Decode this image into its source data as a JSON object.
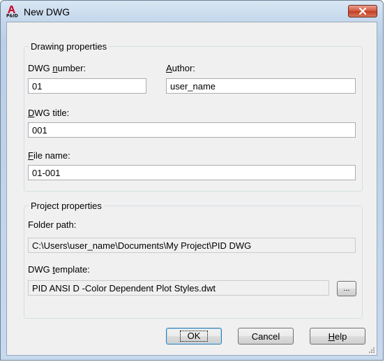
{
  "window": {
    "title": "New DWG",
    "icon": "autocad-pid-app-icon",
    "close_icon": "close-icon"
  },
  "drawing_properties": {
    "legend": "Drawing properties",
    "dwg_number": {
      "label_pre": "DWG ",
      "label_accel": "n",
      "label_post": "umber:",
      "value": "01"
    },
    "author": {
      "label_pre": "",
      "label_accel": "A",
      "label_post": "uthor:",
      "value": "user_name"
    },
    "dwg_title": {
      "label_pre": "",
      "label_accel": "D",
      "label_post": "WG title:",
      "value": "001"
    },
    "file_name": {
      "label_pre": "",
      "label_accel": "F",
      "label_post": "ile name:",
      "value": "01-001"
    }
  },
  "project_properties": {
    "legend": "Project properties",
    "folder_path": {
      "label": "Folder path:",
      "value": "C:\\Users\\user_name\\Documents\\My Project\\PID DWG"
    },
    "dwg_template": {
      "label_pre": "DWG ",
      "label_accel": "t",
      "label_post": "emplate:",
      "value": "PID ANSI D -Color Dependent Plot Styles.dwt"
    },
    "browse_label": "..."
  },
  "buttons": {
    "ok": "OK",
    "cancel": "Cancel",
    "help_accel": "H",
    "help_rest": "elp"
  },
  "colors": {
    "close_button": "#c23d22",
    "default_button_border": "#3c7fb1"
  }
}
